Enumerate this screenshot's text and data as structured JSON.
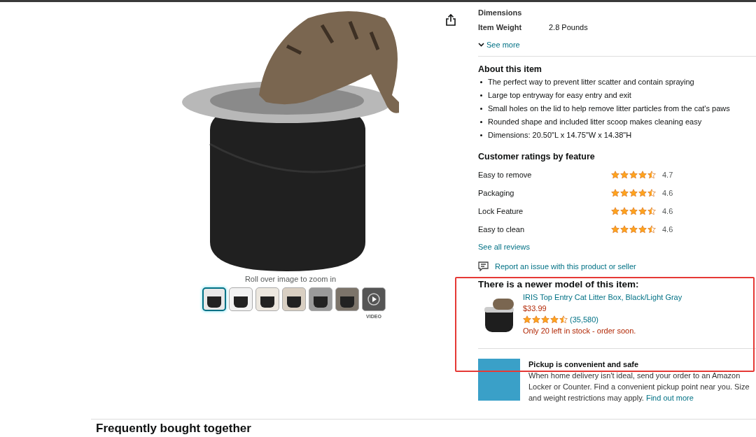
{
  "gallery": {
    "zoom_hint": "Roll over image to zoom in",
    "thumbnails": [
      {
        "kind": "image",
        "selected": true
      },
      {
        "kind": "image",
        "selected": false
      },
      {
        "kind": "image",
        "selected": false
      },
      {
        "kind": "image",
        "selected": false
      },
      {
        "kind": "image",
        "selected": false
      },
      {
        "kind": "image",
        "selected": false
      },
      {
        "kind": "video",
        "selected": false,
        "label": "VIDEO"
      }
    ]
  },
  "specs": [
    {
      "label": "Dimensions"
    },
    {
      "label": "Item Weight",
      "value": "2.8 Pounds"
    }
  ],
  "see_more": "See more",
  "about": {
    "title": "About this item",
    "bullets": [
      "The perfect way to prevent litter scatter and contain spraying",
      "Large top entryway for easy entry and exit",
      "Small holes on the lid to help remove litter particles from the cat's paws",
      "Rounded shape and included litter scoop makes cleaning easy",
      "Dimensions: 20.50\"L x 14.75\"W x 14.38\"H"
    ]
  },
  "ratings": {
    "title": "Customer ratings by feature",
    "rows": [
      {
        "feature": "Easy to remove",
        "stars": 4.5,
        "score": "4.7"
      },
      {
        "feature": "Packaging",
        "stars": 4.5,
        "score": "4.6"
      },
      {
        "feature": "Lock Feature",
        "stars": 4.5,
        "score": "4.6"
      },
      {
        "feature": "Easy to clean",
        "stars": 4.5,
        "score": "4.6"
      }
    ],
    "see_all": "See all reviews"
  },
  "report_link": "Report an issue with this product or seller",
  "newer_model": {
    "heading": "There is a newer model of this item:",
    "title": "IRIS Top Entry Cat Litter Box, Black/Light Gray",
    "price": "$33.99",
    "stars": 4.5,
    "review_count": "(35,580)",
    "stock": "Only 20 left in stock - order soon."
  },
  "pickup": {
    "title": "Pickup is convenient and safe",
    "text": "When home delivery isn't ideal, send your order to an Amazon Locker or Counter. Find a convenient pickup point near you. Size and weight restrictions may apply.",
    "link": "Find out more"
  },
  "section_heading": "Frequently bought together"
}
